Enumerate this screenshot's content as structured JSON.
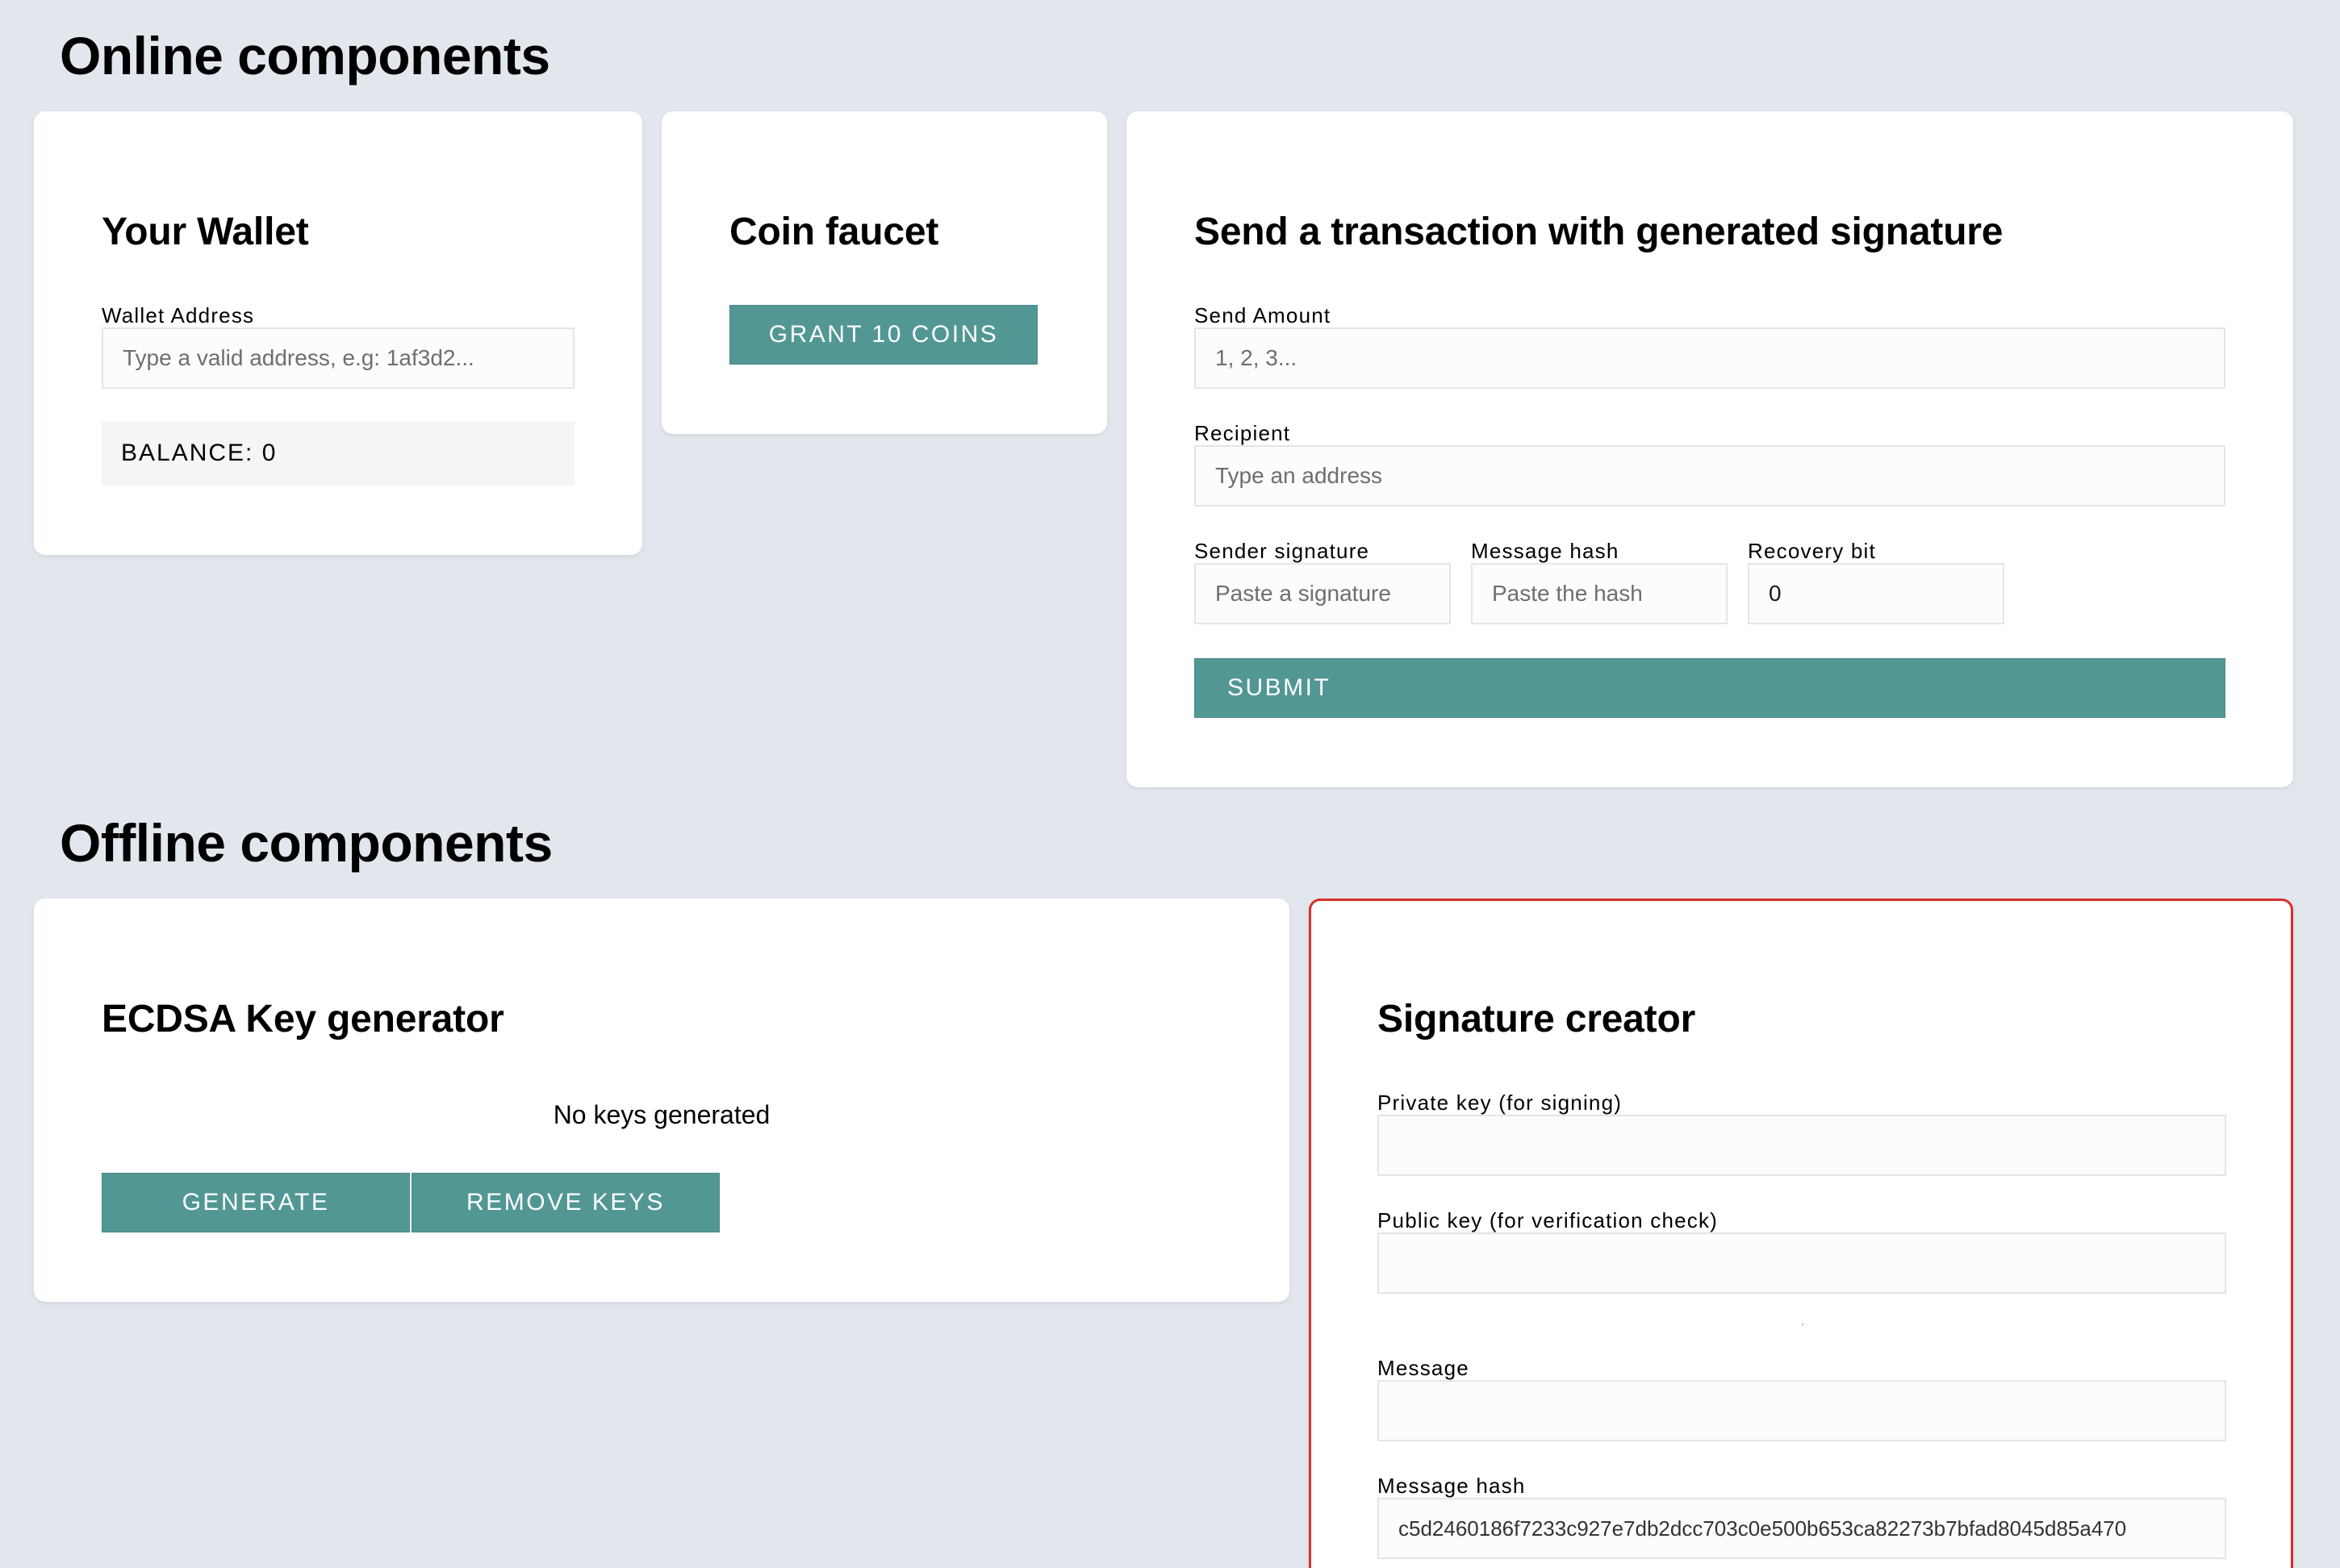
{
  "online": {
    "title": "Online components",
    "wallet": {
      "title": "Your Wallet",
      "address_label": "Wallet Address",
      "address_placeholder": "Type a valid address, e.g: 1af3d2...",
      "balance": "BALANCE: 0"
    },
    "faucet": {
      "title": "Coin faucet",
      "grant_label": "GRANT 10 COINS"
    },
    "transaction": {
      "title": "Send a transaction with generated signature",
      "amount_label": "Send Amount",
      "amount_placeholder": "1, 2, 3...",
      "recipient_label": "Recipient",
      "recipient_placeholder": "Type an address",
      "signature_label": "Sender signature",
      "signature_placeholder": "Paste a signature",
      "hash_label": "Message hash",
      "hash_placeholder": "Paste the hash",
      "recovery_label": "Recovery bit",
      "recovery_value": "0",
      "submit_label": "SUBMIT"
    }
  },
  "offline": {
    "title": "Offline components",
    "keygen": {
      "title": "ECDSA Key generator",
      "status": "No keys generated",
      "generate_label": "GENERATE",
      "remove_label": "REMOVE KEYS"
    },
    "signature": {
      "title": "Signature creator",
      "private_key_label": "Private key (for signing)",
      "private_key_value": "",
      "public_key_label": "Public key (for verification check)",
      "public_key_value": "",
      "message_label": "Message",
      "message_value": "",
      "message_hash_label": "Message hash",
      "message_hash_value": "c5d2460186f7233c927e7db2dcc703c0e500b653ca82273b7bfad8045d85a470"
    }
  },
  "colors": {
    "background": "#e2e7ee",
    "button": "#529794",
    "highlight_border": "#d6312b"
  }
}
